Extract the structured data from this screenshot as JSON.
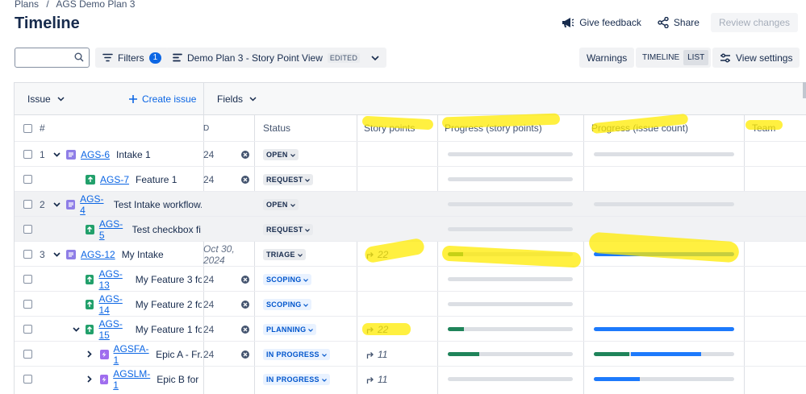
{
  "breadcrumb": {
    "root": "Plans",
    "sep": "/",
    "plan": "AGS Demo Plan 3"
  },
  "title": "Timeline",
  "actions": {
    "feedback": "Give feedback",
    "share": "Share",
    "review": "Review changes"
  },
  "toolbar": {
    "search_value": "",
    "filters": "Filters",
    "filter_count": "1",
    "view_name": "Demo Plan 3 - Story Point View",
    "edited": "EDITED",
    "warnings": "Warnings",
    "timeline": "TIMELINE",
    "list": "LIST",
    "view_settings": "View settings"
  },
  "grid_header": {
    "issue": "Issue",
    "create": "Create issue",
    "fields": "Fields"
  },
  "columns": {
    "hash": "#",
    "date": "D",
    "status": "Status",
    "story_points": "Story points",
    "progress_sp": "Progress (story points)",
    "progress_ic": "Progress (issue count)",
    "team": "Team"
  },
  "rows": [
    {
      "num": "1",
      "key": "AGS-6",
      "summary": "Intake 1",
      "date": "24",
      "clear": true,
      "status": "OPEN",
      "status_color": "gray",
      "sp": "",
      "sp_progress": 0,
      "ic_progress": 0,
      "ic_show": true,
      "alt": false,
      "indent": 0,
      "expand": "down",
      "type": "intake"
    },
    {
      "num": "",
      "key": "AGS-7",
      "summary": "Feature 1",
      "date": "24",
      "clear": true,
      "status": "REQUEST",
      "status_color": "gray",
      "sp": "",
      "sp_progress": 0,
      "ic_progress": 0,
      "ic_show": false,
      "alt": false,
      "indent": 1,
      "expand": "",
      "type": "feature"
    },
    {
      "num": "2",
      "key": "AGS-4",
      "summary": "Test Intake workflow...",
      "date": "",
      "clear": false,
      "status": "OPEN",
      "status_color": "gray",
      "sp": "",
      "sp_progress": 0,
      "ic_progress": 0,
      "ic_show": true,
      "alt": true,
      "indent": 0,
      "expand": "down",
      "type": "intake"
    },
    {
      "num": "",
      "key": "AGS-5",
      "summary": "Test checkbox fi...",
      "date": "",
      "clear": false,
      "status": "REQUEST",
      "status_color": "gray",
      "sp": "",
      "sp_progress": 0,
      "ic_progress": 0,
      "ic_show": false,
      "alt": true,
      "indent": 1,
      "expand": "",
      "type": "feature"
    },
    {
      "num": "3",
      "key": "AGS-12",
      "summary": "My Intake",
      "date": "Oct 30, 2024",
      "clear": false,
      "status": "TRIAGE",
      "status_color": "gray",
      "sp": "22",
      "sp_progress": 0.12,
      "ic_progress": 0.0,
      "ic_full_blue": true,
      "ic_show": true,
      "alt": false,
      "indent": 0,
      "expand": "down",
      "type": "intake"
    },
    {
      "num": "",
      "key": "AGS-13",
      "summary": "My Feature 3 fo...",
      "date": "24",
      "clear": true,
      "status": "SCOPING",
      "status_color": "blue",
      "sp": "",
      "sp_progress": 0,
      "ic_progress": 0,
      "ic_show": false,
      "alt": false,
      "indent": 1,
      "expand": "",
      "type": "feature"
    },
    {
      "num": "",
      "key": "AGS-14",
      "summary": "My Feature 2 fo...",
      "date": "24",
      "clear": true,
      "status": "SCOPING",
      "status_color": "blue",
      "sp": "",
      "sp_progress": 0,
      "ic_progress": 0,
      "ic_show": false,
      "alt": false,
      "indent": 1,
      "expand": "",
      "type": "feature"
    },
    {
      "num": "",
      "key": "AGS-15",
      "summary": "My Feature 1 fo...",
      "date": "24",
      "clear": true,
      "status": "PLANNING",
      "status_color": "blue",
      "sp": "22",
      "sp_progress": 0.13,
      "ic_progress": 0.0,
      "ic_full_blue": true,
      "ic_show": true,
      "alt": false,
      "indent": 1,
      "expand": "down",
      "type": "feature"
    },
    {
      "num": "",
      "key": "AGSFA-1",
      "summary": "Epic A - Fr...",
      "date": "24",
      "clear": true,
      "status": "IN PROGRESS",
      "status_color": "blue",
      "sp": "11",
      "sp_progress": 0.25,
      "ic_progress": 0.25,
      "ic_blue_to": 0.75,
      "ic_show": true,
      "alt": false,
      "indent": 2,
      "expand": "right",
      "type": "epic"
    },
    {
      "num": "",
      "key": "AGSLM-1",
      "summary": "Epic B for ...",
      "date": "",
      "clear": false,
      "status": "IN PROGRESS",
      "status_color": "blue",
      "sp": "11",
      "sp_progress": 0,
      "ic_progress": 0,
      "ic_blue_to": 0.33,
      "ic_show": true,
      "alt": false,
      "indent": 2,
      "expand": "right",
      "type": "epic"
    }
  ],
  "colors": {
    "accent": "#0c66e4",
    "green": "#1f845a",
    "blue": "#1d7afc",
    "highlight": "#ffeb00"
  }
}
